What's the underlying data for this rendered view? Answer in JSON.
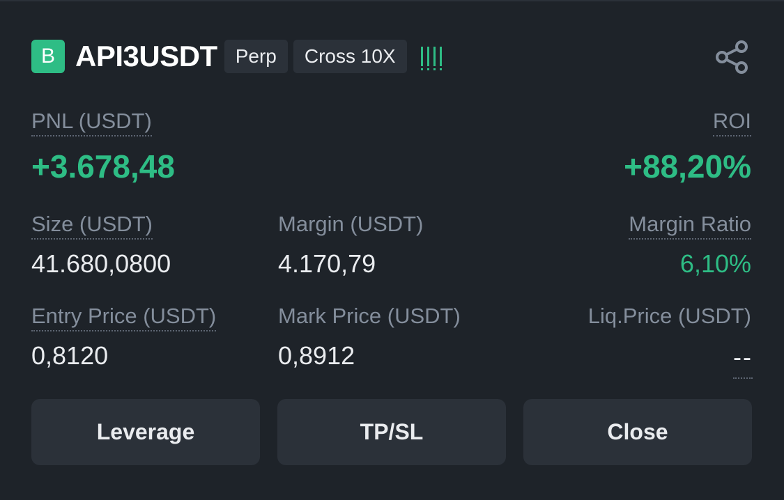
{
  "position": {
    "side_badge": "B",
    "symbol": "API3USDT",
    "tags": [
      "Perp",
      "Cross 10X"
    ],
    "adl_bars": 4,
    "share_icon": "share-icon"
  },
  "pnl": {
    "label": "PNL (USDT)",
    "value": "+3.678,48"
  },
  "roi": {
    "label": "ROI",
    "value": "+88,20%"
  },
  "size": {
    "label": "Size (USDT)",
    "value": "41.680,0800"
  },
  "margin": {
    "label": "Margin (USDT)",
    "value": "4.170,79"
  },
  "margin_ratio": {
    "label": "Margin Ratio",
    "value": "6,10%"
  },
  "entry_price": {
    "label": "Entry Price (USDT)",
    "value": "0,8120"
  },
  "mark_price": {
    "label": "Mark Price (USDT)",
    "value": "0,8912"
  },
  "liq_price": {
    "label": "Liq.Price (USDT)",
    "value": "--"
  },
  "buttons": {
    "leverage": "Leverage",
    "tpsl": "TP/SL",
    "close": "Close"
  },
  "colors": {
    "background": "#1e2329",
    "positive": "#2ebd85",
    "muted": "#848e9c",
    "surface": "#2b3139"
  }
}
